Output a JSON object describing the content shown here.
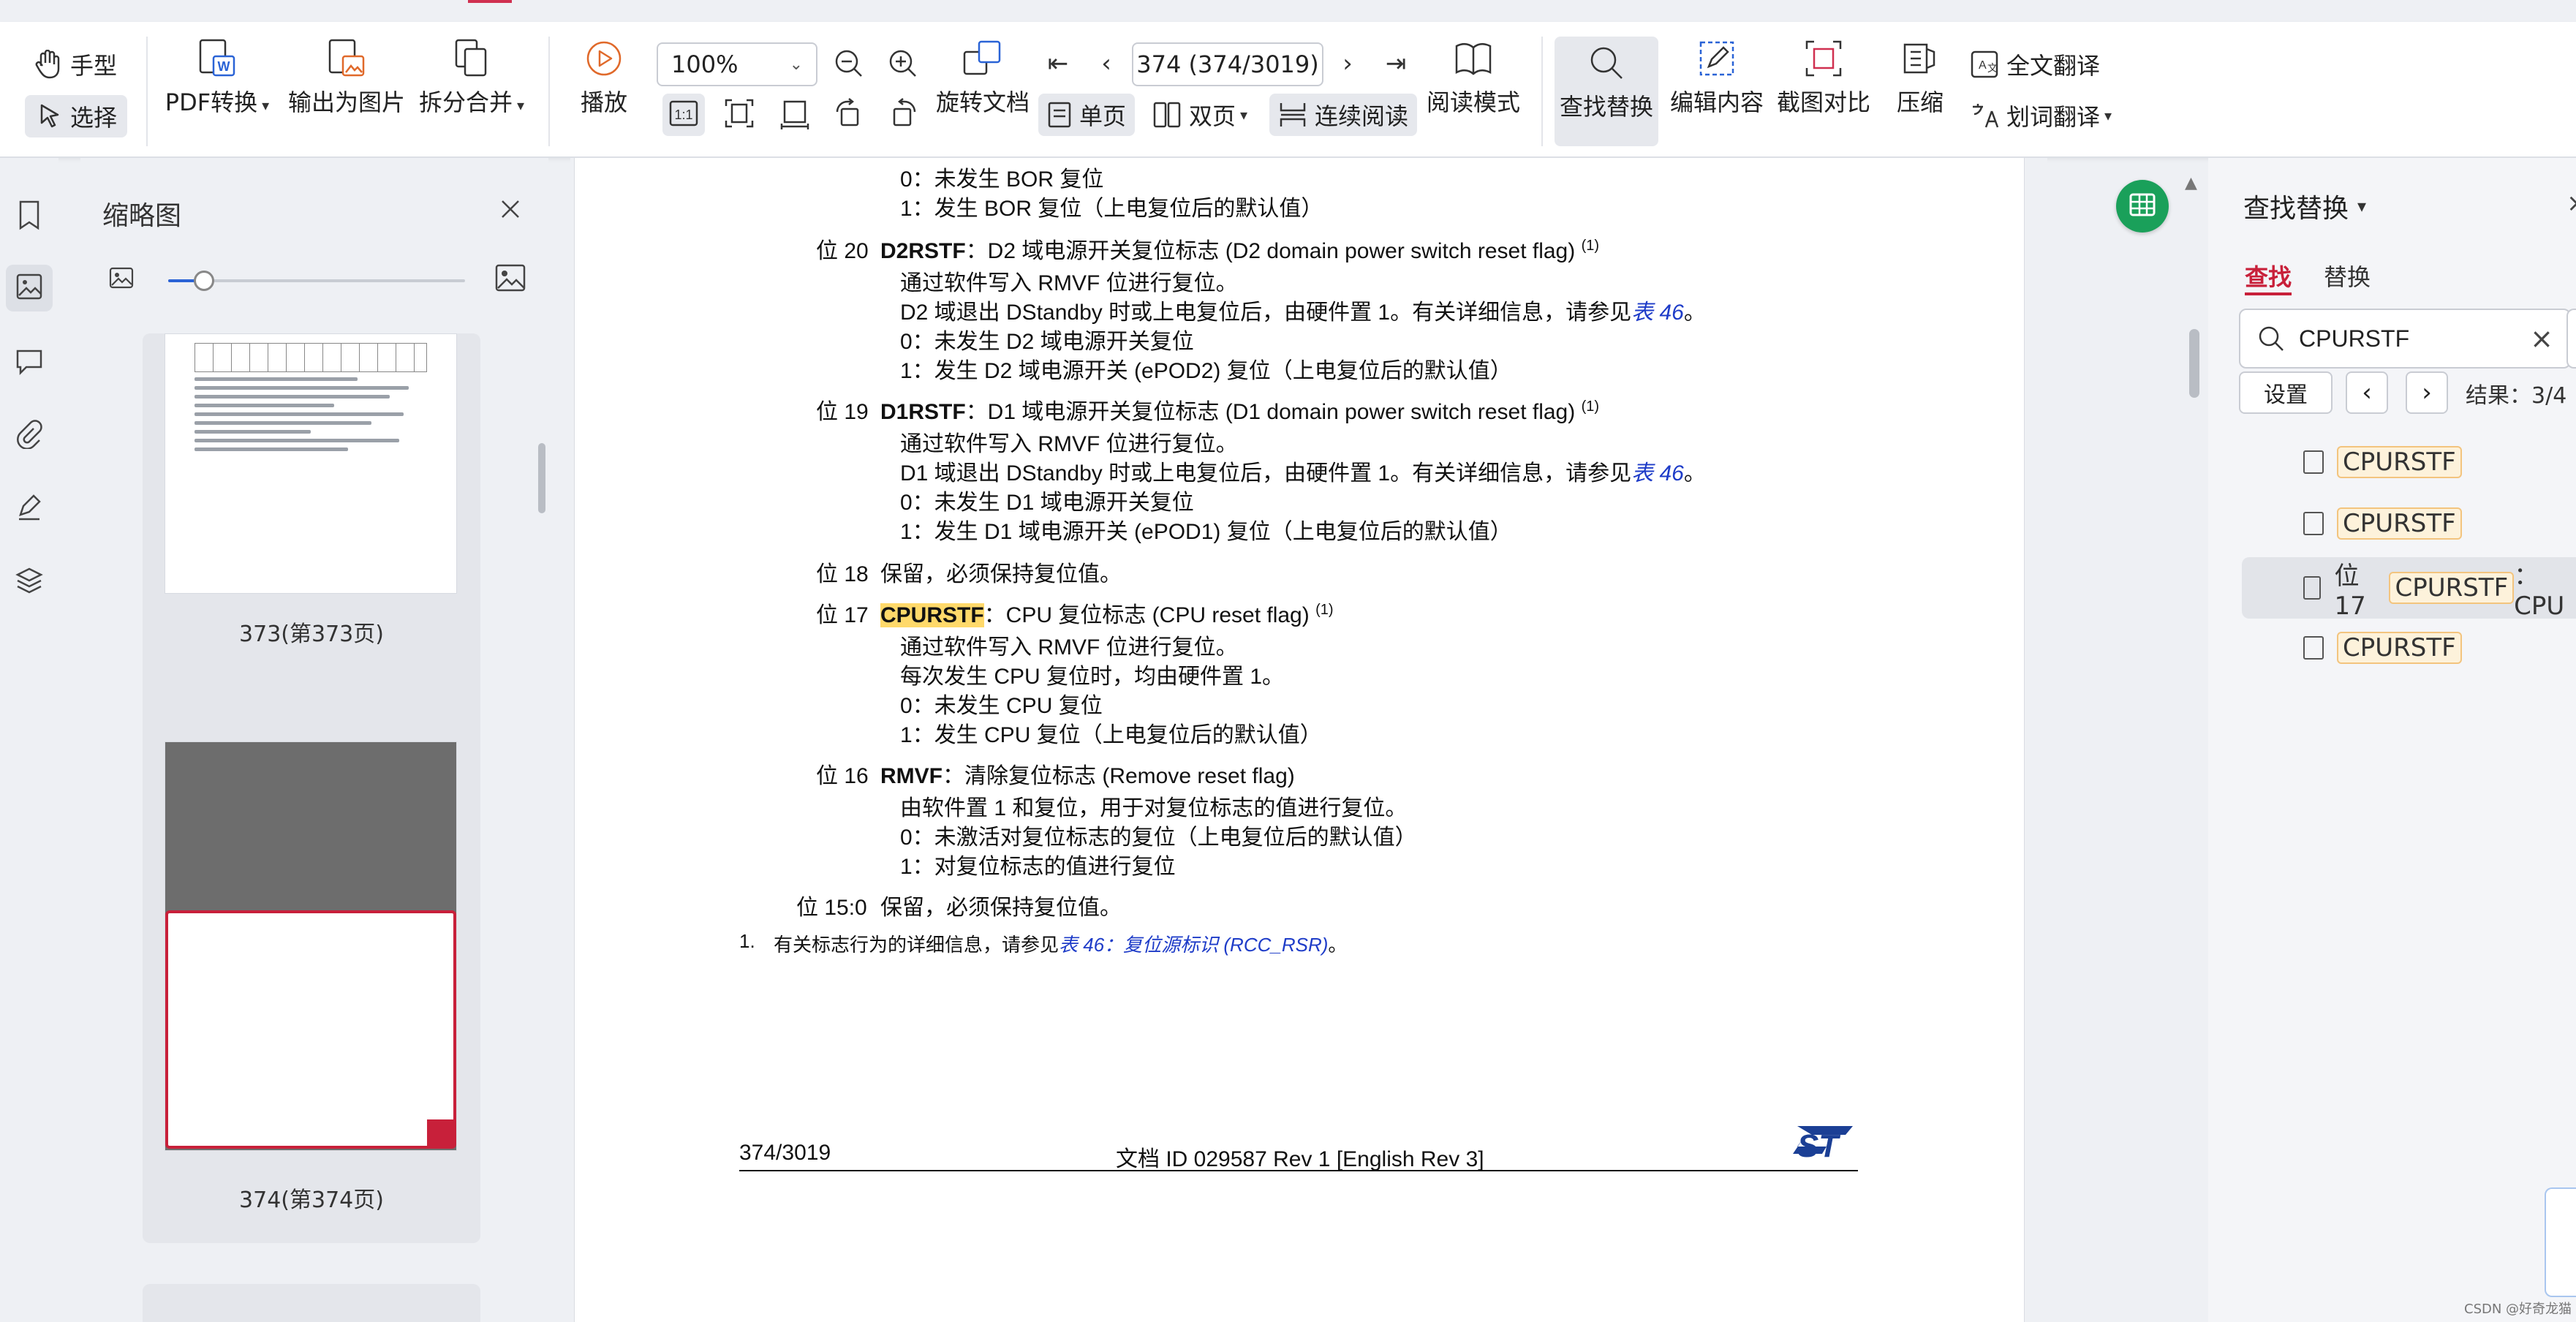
{
  "toolbar": {
    "hand_label": "手型",
    "select_label": "选择",
    "pdf_convert_label": "PDF转换",
    "export_image_label": "输出为图片",
    "split_merge_label": "拆分合并",
    "play_label": "播放",
    "zoom_value": "100%",
    "page_value": "374 (374/3019)",
    "rotate_label": "旋转文档",
    "single_page_label": "单页",
    "double_page_label": "双页",
    "continuous_label": "连续阅读",
    "read_mode_label": "阅读模式",
    "find_replace_label": "查找替换",
    "edit_content_label": "编辑内容",
    "screenshot_compare_label": "截图对比",
    "compress_label": "压缩",
    "full_translate_label": "全文翻译",
    "word_translate_label": "划词翻译"
  },
  "thumbnails": {
    "title": "缩略图",
    "zoom_level": 0.12,
    "items": [
      {
        "label": "373(第373页)",
        "selected": false
      },
      {
        "label": "374(第374页)",
        "selected": true
      }
    ]
  },
  "document": {
    "lines": {
      "l1": "0：未发生 BOR 复位",
      "l2": "1：发生 BOR 复位（上电复位后的默认值）",
      "b20_pos": "位 20",
      "b20_name": "D2RSTF",
      "b20_title": "：D2 域电源开关复位标志 (D2 domain power switch reset flag)",
      "b20_sup": "(1)",
      "b20_1": "通过软件写入 RMVF 位进行复位。",
      "b20_2": "D2 域退出 DStandby 时或上电复位后，由硬件置 1。有关详细信息，请参见",
      "b20_2_link": "表 46",
      "b20_2_end": "。",
      "b20_3": "0：未发生 D2 域电源开关复位",
      "b20_4": "1：发生 D2 域电源开关 (ePOD2) 复位（上电复位后的默认值）",
      "b19_pos": "位 19",
      "b19_name": "D1RSTF",
      "b19_title": "：D1 域电源开关复位标志 (D1 domain power switch reset flag)",
      "b19_sup": "(1)",
      "b19_1": "通过软件写入 RMVF 位进行复位。",
      "b19_2": "D1 域退出 DStandby 时或上电复位后，由硬件置 1。有关详细信息，请参见",
      "b19_2_link": "表 46",
      "b19_2_end": "。",
      "b19_3": "0：未发生 D1 域电源开关复位",
      "b19_4": "1：发生 D1 域电源开关 (ePOD1) 复位（上电复位后的默认值）",
      "b18_pos": "位 18",
      "b18_text": "保留，必须保持复位值。",
      "b17_pos": "位 17",
      "b17_name": "CPURSTF",
      "b17_title": "：CPU 复位标志 (CPU reset flag)",
      "b17_sup": "(1)",
      "b17_1": "通过软件写入 RMVF 位进行复位。",
      "b17_2": "每次发生 CPU 复位时，均由硬件置 1。",
      "b17_3": "0：未发生 CPU 复位",
      "b17_4": "1：发生 CPU 复位（上电复位后的默认值）",
      "b16_pos": "位 16",
      "b16_name": "RMVF",
      "b16_title": "：清除复位标志 (Remove reset flag)",
      "b16_1": "由软件置 1 和复位，用于对复位标志的值进行复位。",
      "b16_2": "0：未激活对复位标志的复位（上电复位后的默认值）",
      "b16_3": "1：对复位标志的值进行复位",
      "b15_pos": "位 15:0",
      "b15_text": "保留，必须保持复位值。",
      "fn_num": "1.",
      "fn_text": "有关标志行为的详细信息，请参见",
      "fn_link": "表 46：复位源标识 (RCC_RSR)",
      "fn_end": "。"
    },
    "footer_page": "374/3019",
    "footer_doc": "文档 ID 029587 Rev 1 [English Rev 3]",
    "logo_text": "ST"
  },
  "find_panel": {
    "title": "查找替换",
    "tab_find": "查找",
    "tab_replace": "替换",
    "search_value": "CPURSTF",
    "settings_label": "设置",
    "result_count": "结果：3/4",
    "results": [
      {
        "prefix": "",
        "match": "CPURSTF",
        "suffix": "",
        "selected": false
      },
      {
        "prefix": "",
        "match": "CPURSTF",
        "suffix": "",
        "selected": false
      },
      {
        "prefix": "位 17 ",
        "match": "CPURSTF",
        "suffix": "：CPU",
        "selected": true
      },
      {
        "prefix": "",
        "match": "CPURSTF",
        "suffix": "",
        "selected": false
      }
    ]
  },
  "watermark": "CSDN @好奇龙猫",
  "colors": {
    "accent": "#d03050",
    "highlight": "#ffd96a",
    "link": "#1e3cc8",
    "green_badge": "#1aa05a"
  }
}
